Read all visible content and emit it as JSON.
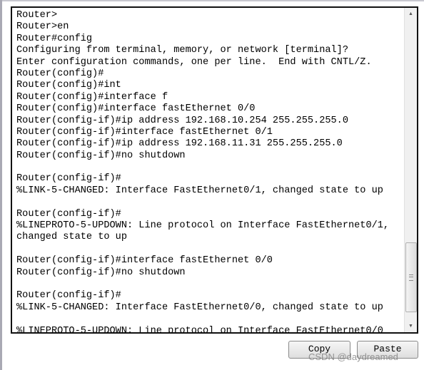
{
  "terminal": {
    "lines": [
      "Router>",
      "Router>en",
      "Router#config",
      "Configuring from terminal, memory, or network [terminal]?",
      "Enter configuration commands, one per line.  End with CNTL/Z.",
      "Router(config)#",
      "Router(config)#int",
      "Router(config)#interface f",
      "Router(config)#interface fastEthernet 0/0",
      "Router(config-if)#ip address 192.168.10.254 255.255.255.0",
      "Router(config-if)#interface fastEthernet 0/1",
      "Router(config-if)#ip address 192.168.11.31 255.255.255.0",
      "Router(config-if)#no shutdown",
      "",
      "Router(config-if)#",
      "%LINK-5-CHANGED: Interface FastEthernet0/1, changed state to up",
      "",
      "Router(config-if)#",
      "%LINEPROTO-5-UPDOWN: Line protocol on Interface FastEthernet0/1,",
      "changed state to up",
      "",
      "Router(config-if)#interface fastEthernet 0/0",
      "Router(config-if)#no shutdown",
      "",
      "Router(config-if)#",
      "%LINK-5-CHANGED: Interface FastEthernet0/0, changed state to up",
      "",
      "%LINEPROTO-5-UPDOWN: Line protocol on Interface FastEthernet0/0"
    ],
    "scroll_position": 0.85
  },
  "buttons": {
    "copy": "Copy",
    "paste": "Paste"
  },
  "watermark": "CSDN @daydreamed"
}
